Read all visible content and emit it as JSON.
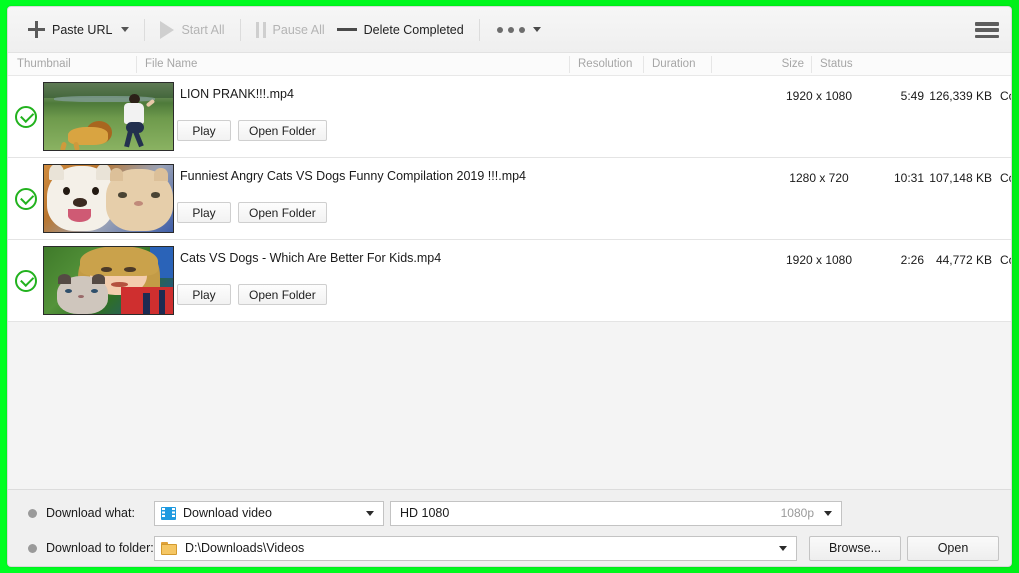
{
  "window": {
    "accent_border": "#00f41c",
    "background": "#f0f0f0"
  },
  "toolbar": {
    "paste_url": "Paste URL",
    "start_all": "Start All",
    "pause_all": "Pause All",
    "delete_completed": "Delete Completed",
    "more_icon": "three-dots-icon",
    "menu_icon": "hamburger-menu-icon"
  },
  "columns": {
    "thumbnail": "Thumbnail",
    "file_name": "File Name",
    "resolution": "Resolution",
    "duration": "Duration",
    "size": "Size",
    "status": "Status"
  },
  "row_buttons": {
    "play": "Play",
    "open_folder": "Open Folder"
  },
  "downloads": [
    {
      "state_icon": "check-circle-icon",
      "file_name": "LION PRANK!!!.mp4",
      "resolution": "1920 x 1080",
      "duration": "5:49",
      "size": "126,339 KB",
      "status": "Completed"
    },
    {
      "state_icon": "check-circle-icon",
      "file_name": "Funniest Angry Cats VS Dogs Funny Compilation 2019 !!!.mp4",
      "resolution": "1280 x 720",
      "duration": "10:31",
      "size": "107,148 KB",
      "status": "Completed"
    },
    {
      "state_icon": "check-circle-icon",
      "file_name": "Cats VS Dogs - Which Are Better For Kids.mp4",
      "resolution": "1920 x 1080",
      "duration": "2:26",
      "size": "44,772 KB",
      "status": "Completed"
    }
  ],
  "bottom": {
    "download_what_label": "Download what:",
    "download_what_value": "Download video",
    "download_what_icon": "film-strip-icon",
    "quality_value": "HD 1080",
    "quality_suffix": "1080p",
    "download_to_folder_label": "Download to folder:",
    "folder_value": "D:\\Downloads\\Videos",
    "folder_icon": "folder-icon",
    "browse_button": "Browse...",
    "open_button": "Open"
  }
}
